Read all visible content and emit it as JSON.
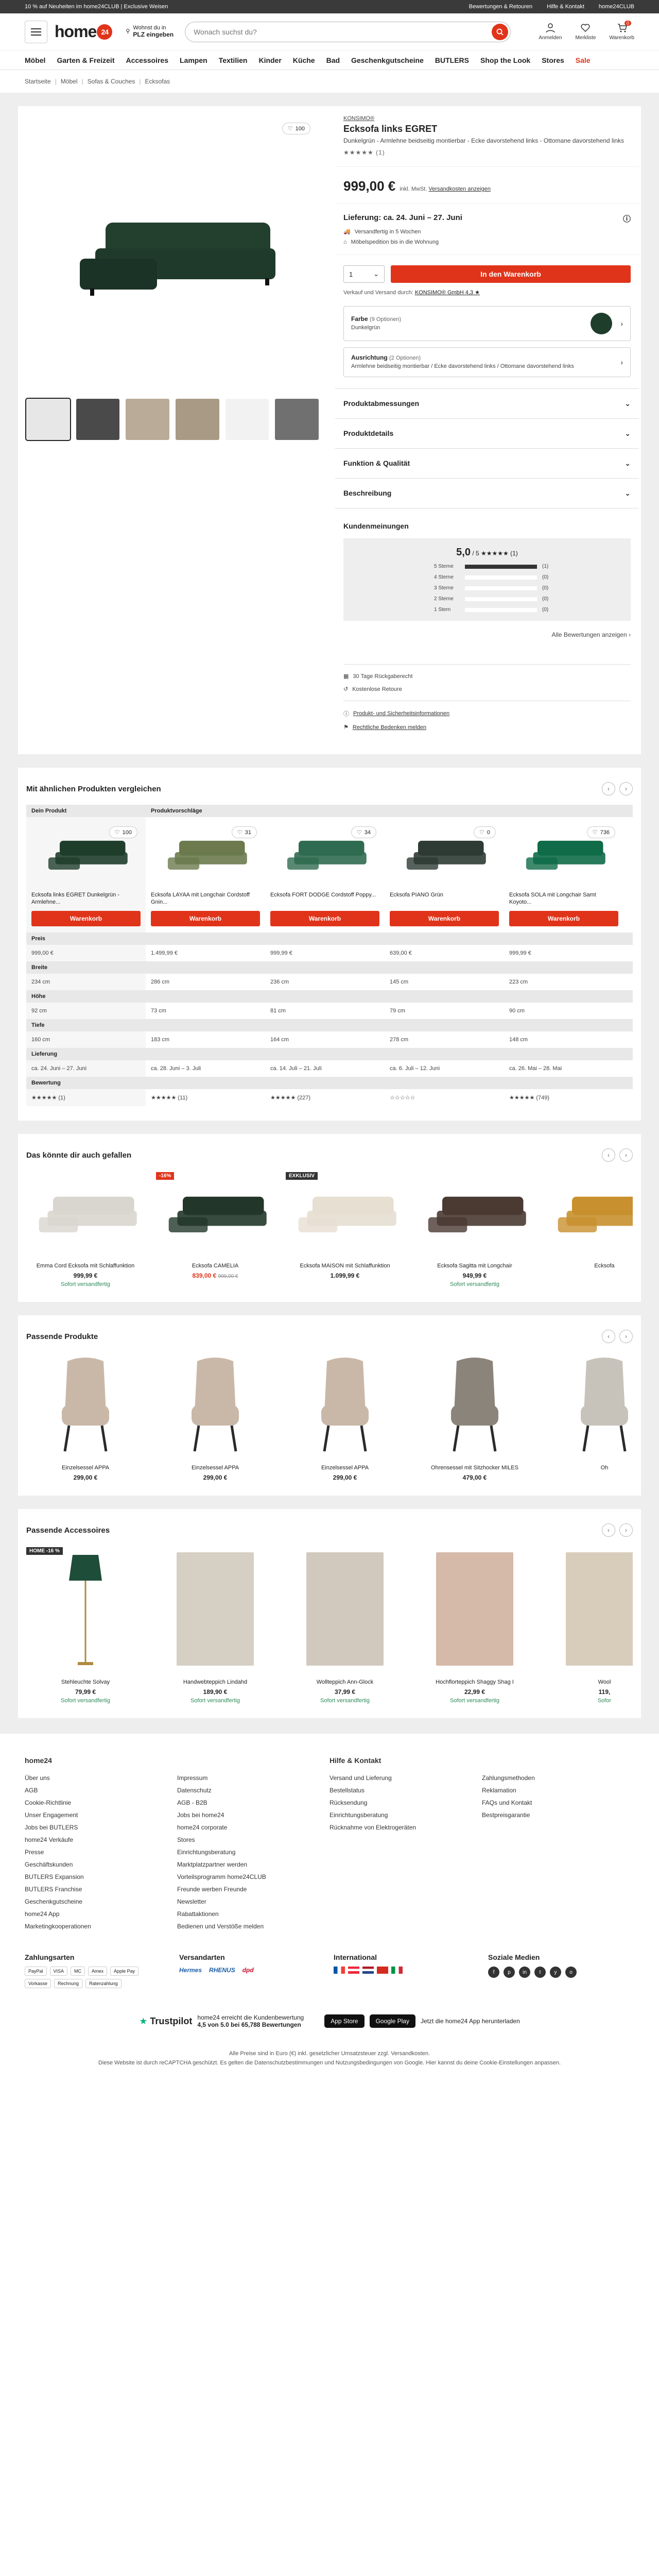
{
  "topbar": {
    "promo": "10 % auf Neuheiten im home24CLUB | Exclusive Weisen",
    "links": [
      "Bewertungen & Retouren",
      "Hilfe & Kontakt",
      "home24CLUB"
    ]
  },
  "header": {
    "logo": "home",
    "logo_badge": "24",
    "loc_label": "Wohnst du in",
    "loc_value": "PLZ eingeben",
    "search_placeholder": "Wonach suchst du?",
    "icons": [
      {
        "label": "Anmelden",
        "name": "user-icon"
      },
      {
        "label": "Merkliste",
        "name": "heart-icon"
      },
      {
        "label": "Warenkorb",
        "name": "cart-icon",
        "count": "0"
      }
    ]
  },
  "nav": [
    "Möbel",
    "Garten & Freizeit",
    "Accessoires",
    "Lampen",
    "Textilien",
    "Kinder",
    "Küche",
    "Bad",
    "Geschenkgutscheine",
    "BUTLERS",
    "Shop the Look",
    "Stores",
    "Sale"
  ],
  "breadcrumb": [
    "Startseite",
    "Möbel",
    "Sofas & Couches",
    "Ecksofas"
  ],
  "product": {
    "wish_count": "100",
    "brand": "KONSIMO®",
    "title": "Ecksofa links EGRET",
    "subtitle": "Dunkelgrün - Armlehne beidseitig montierbar - Ecke davorstehend links - Ottomane davorstehend links",
    "stars": "★★★★★ (1)",
    "price": "999,00 €",
    "price_note_a": "inkl. MwSt.",
    "price_note_b": "Versandkosten anzeigen",
    "delivery": "Lieferung: ca. 24. Juni – 27. Juni",
    "delivery_lines": [
      "Versandfertig in 5 Wochen",
      "Möbelspedition bis in die Wohnung"
    ],
    "qty": "1",
    "cart": "In den Warenkorb",
    "seller_a": "Verkauf und Versand durch:",
    "seller_b": "KONSIMO® GmbH 4,3 ★",
    "color_label": "Farbe",
    "color_count": "(9 Optionen)",
    "color_value": "Dunkelgrün",
    "align_label": "Ausrichtung",
    "align_count": "(2 Optionen)",
    "align_value": "Armlehne beidseitig montierbar / Ecke davorstehend links / Ottomane davorstehend links",
    "accordions": [
      "Produktabmessungen",
      "Produktdetails",
      "Funktion & Qualität",
      "Beschreibung"
    ],
    "reviews_title": "Kundenmeinungen",
    "score": "5,0",
    "score_of": "/ 5",
    "score_stars": "★★★★★ (1)",
    "rating_rows": [
      {
        "label": "5 Sterne",
        "count": "(1)",
        "pct": 1
      },
      {
        "label": "4 Sterne",
        "count": "(0)",
        "pct": 0
      },
      {
        "label": "3 Sterne",
        "count": "(0)",
        "pct": 0
      },
      {
        "label": "2 Sterne",
        "count": "(0)",
        "pct": 0
      },
      {
        "label": "1 Stern",
        "count": "(0)",
        "pct": 0
      }
    ],
    "all_reviews": "Alle Bewertungen anzeigen",
    "extras": [
      "30 Tage Rückgaberecht",
      "Kostenlose Retoure"
    ],
    "extras2": [
      "Produkt- und Sicherheitsinformationen",
      "Rechtliche Bedenken melden"
    ]
  },
  "compare": {
    "title": "Mit ähnlichen Produkten vergleichen",
    "own_label": "Dein Produkt",
    "sugg_label": "Produktvorschläge",
    "items": [
      {
        "wish": "100",
        "name": "Ecksofa links EGRET Dunkelgrün - Armlehne...",
        "color": "#1f3d2b"
      },
      {
        "wish": "31",
        "name": "Ecksofa LAYAA mit Longchair Cordstoff Gnin...",
        "color": "#6c7a4e"
      },
      {
        "wish": "34",
        "name": "Ecksofa FORT DODGE Cordstoff Poppy...",
        "color": "#2f6b50"
      },
      {
        "wish": "0",
        "name": "Ecksofa PIANO Grün",
        "color": "#2d3b34"
      },
      {
        "wish": "736",
        "name": "Ecksofa SOLA mit Longchair Samt Koyoto...",
        "color": "#0f6b48"
      }
    ],
    "button": "Warenkorb",
    "rows": [
      {
        "label": "Preis",
        "values": [
          "999,00 €",
          "1.499,99 €",
          "999,99 €",
          "639,00 €",
          "999,99 €"
        ]
      },
      {
        "label": "Breite",
        "values": [
          "234 cm",
          "286 cm",
          "236 cm",
          "145 cm",
          "223 cm"
        ]
      },
      {
        "label": "Höhe",
        "values": [
          "92 cm",
          "73 cm",
          "81 cm",
          "79 cm",
          "90 cm"
        ]
      },
      {
        "label": "Tiefe",
        "values": [
          "160 cm",
          "183 cm",
          "164 cm",
          "278 cm",
          "148 cm"
        ]
      },
      {
        "label": "Lieferung",
        "values": [
          "ca. 24. Juni – 27. Juni",
          "ca. 28. Juni – 3. Juli",
          "ca. 14. Juli – 21. Juli",
          "ca. 6. Juli – 12. Juni",
          "ca. 26. Mai – 28. Mai"
        ]
      },
      {
        "label": "Bewertung",
        "values": [
          "★★★★★ (1)",
          "★★★★★ (11)",
          "★★★★★ (227)",
          "☆☆☆☆☆",
          "★★★★★ (749)"
        ]
      }
    ]
  },
  "like": {
    "title": "Das könnte dir auch gefallen",
    "items": [
      {
        "flag": "",
        "name": "Emma Cord Ecksofa mit Schlaffunktion",
        "price": "999,99 €",
        "old": "",
        "deliv": "Sofort versandfertig",
        "color": "#d9d6cf"
      },
      {
        "flag": "-16%",
        "flagcolor": "#e0341a",
        "name": "Ecksofa CAMELIA",
        "price": "839,00 €",
        "old": "999,00 €",
        "deliv": "",
        "color": "#22372a"
      },
      {
        "flag": "EXKLUSIV",
        "flagcolor": "#333",
        "name": "Ecksofa MAISON mit Schlaffunktion",
        "price": "1.099,99 €",
        "old": "",
        "deliv": "",
        "color": "#e6dfd2"
      },
      {
        "flag": "",
        "name": "Ecksofa Sagitta mit Longchair",
        "price": "949,99 €",
        "old": "",
        "deliv": "Sofort versandfertig",
        "color": "#4a3a32"
      },
      {
        "flag": "",
        "name": "Ecksofa",
        "price": "",
        "old": "",
        "deliv": "",
        "color": "#c8902e"
      }
    ]
  },
  "match": {
    "title": "Passende Produkte",
    "items": [
      {
        "name": "Einzelsessel APPA",
        "price": "299,00 €",
        "color": "#c9b8a8"
      },
      {
        "name": "Einzelsessel APPA",
        "price": "299,00 €",
        "color": "#c9b8a8"
      },
      {
        "name": "Einzelsessel APPA",
        "price": "299,00 €",
        "color": "#c9b8a8"
      },
      {
        "name": "Ohrensessel mit Sitzhocker MILES",
        "price": "479,00 €",
        "color": "#8b847a"
      },
      {
        "name": "Oh",
        "price": "",
        "color": "#c7c3ba"
      }
    ]
  },
  "acc": {
    "title": "Passende Accessoires",
    "items": [
      {
        "flag": "HOME -16 %",
        "name": "Stehleuchte Solvay",
        "price": "79,99 €",
        "deliv": "Sofort versandfertig",
        "color": "#1e4d3a"
      },
      {
        "flag": "",
        "name": "Handwebteppich Lindahd",
        "price": "189,90 €",
        "deliv": "Sofort versandfertig",
        "color": "#d6cfc4"
      },
      {
        "flag": "",
        "name": "Wollteppich Ann-Glock",
        "price": "37,99 €",
        "deliv": "Sofort versandfertig",
        "color": "#d1c9bd"
      },
      {
        "flag": "",
        "name": "Hochflorteppich Shaggy Shag I",
        "price": "22,99 €",
        "deliv": "Sofort versandfertig",
        "color": "#d5b9a9"
      },
      {
        "flag": "",
        "name": "Wool",
        "price": "119,",
        "deliv": "Sofor",
        "color": "#d8cdbb"
      }
    ]
  },
  "footer": {
    "cols": [
      {
        "title": "home24",
        "links": [
          "Über uns",
          "AGB",
          "Cookie-Richtlinie",
          "Unser Engagement",
          "Jobs bei BUTLERS",
          "home24 Verkäufe",
          "Presse",
          "Geschäftskunden",
          "BUTLERS Expansion",
          "BUTLERS Franchise",
          "Geschenkgutscheine",
          "home24 App",
          "Marketingkooperationen"
        ]
      },
      {
        "title": "",
        "links": [
          "Impressum",
          "Datenschutz",
          "AGB - B2B",
          "Jobs bei home24",
          "home24 corporate",
          "Stores",
          "Einrichtungsberatung",
          "Marktplatzpartner werden",
          "Vorteilsprogramm home24CLUB",
          "Freunde werben Freunde",
          "Newsletter",
          "Rabattaktionen",
          "Bedienen und Verstöße melden"
        ]
      },
      {
        "title": "Hilfe & Kontakt",
        "links": [
          "Versand und Lieferung",
          "Bestellstatus",
          "Rücksendung",
          "Einrichtungsberatung",
          "Rücknahme von Elektrogeräten"
        ]
      },
      {
        "title": "",
        "links": [
          "Zahlungsmethoden",
          "Reklamation",
          "FAQs und Kontakt",
          "Bestpreisgarantie"
        ]
      }
    ],
    "pay_title": "Zahlungsarten",
    "pay": [
      "PayPal",
      "VISA",
      "MC",
      "Amex",
      "Apple Pay",
      "Vorkasse",
      "Rechnung",
      "Ratenzahlung"
    ],
    "ship_title": "Versandarten",
    "ship": [
      "Hermes",
      "RHENUS",
      "dpd"
    ],
    "intl_title": "International",
    "social_title": "Soziale Medien",
    "social": [
      "f",
      "p",
      "in",
      "t",
      "y",
      "o"
    ],
    "trust_text": "home24 erreicht die Kundenbewertung",
    "trust_score": "4,5 von 5.0 bei 65,788 Bewertungen",
    "trustpilot": "Trustpilot",
    "app_text": "Jetzt die home24 App herunterladen",
    "app_store": "App Store",
    "google_play": "Google Play",
    "legal1": "Alle Preise sind in Euro (€) inkl. gesetzlicher Umsatzsteuer zzgl. Versandkosten.",
    "legal2": "Diese Website ist durch reCAPTCHA geschützt. Es gelten die Datenschutzbestimmungen und Nutzungsbedingungen von Google. Hier kannst du deine Cookie-Einstellungen anpassen."
  },
  "colors": {
    "accent": "#e0341a",
    "sofa": "#1f3d2b"
  }
}
